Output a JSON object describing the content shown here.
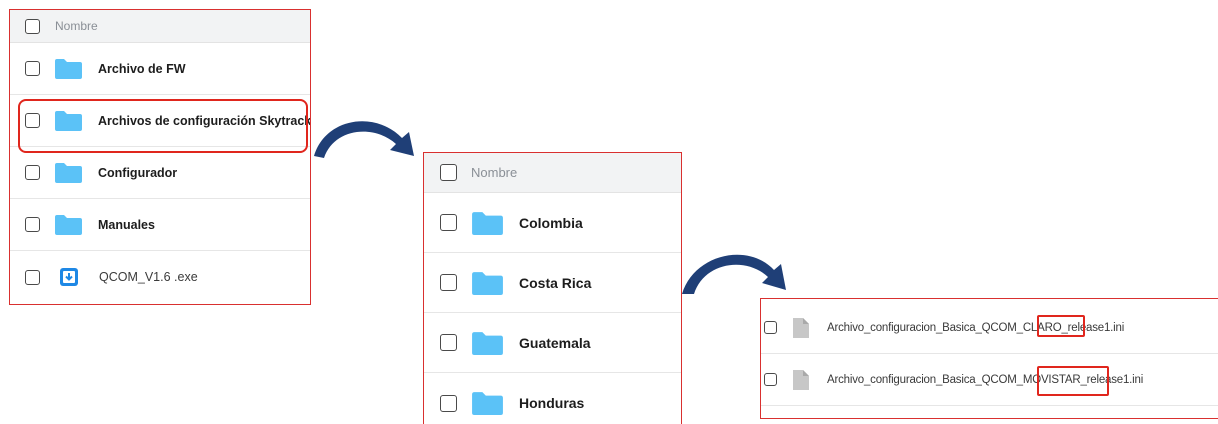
{
  "panel1": {
    "header": "Nombre",
    "items": [
      {
        "label": "Archivo de FW",
        "icon": "folder-icon"
      },
      {
        "label": "Archivos de configuración Skytrack",
        "icon": "folder-icon"
      },
      {
        "label": "Configurador",
        "icon": "folder-icon"
      },
      {
        "label": "Manuales",
        "icon": "folder-icon"
      },
      {
        "label": "QCOM_V1.6 .exe",
        "icon": "download-file-icon"
      }
    ]
  },
  "panel2": {
    "header": "Nombre",
    "items": [
      {
        "label": "Colombia",
        "icon": "folder-icon"
      },
      {
        "label": "Costa Rica",
        "icon": "folder-icon"
      },
      {
        "label": "Guatemala",
        "icon": "folder-icon"
      },
      {
        "label": "Honduras",
        "icon": "folder-icon"
      }
    ]
  },
  "panel3": {
    "items": [
      {
        "prefix": "Archivo_configuracion_Basica_QCOM_",
        "highlight": "CLARO",
        "suffix": "_release1.ini",
        "icon": "file-icon"
      },
      {
        "prefix": "Archivo_configuracion_Basica_QCOM_",
        "highlight": "MOVISTAR",
        "suffix": "_release1.ini",
        "icon": "file-icon"
      }
    ]
  },
  "colors": {
    "panel_border": "#d9302f",
    "highlight": "#e0261d",
    "folder": "#5bc2f7",
    "arrow": "#1f3f77"
  }
}
